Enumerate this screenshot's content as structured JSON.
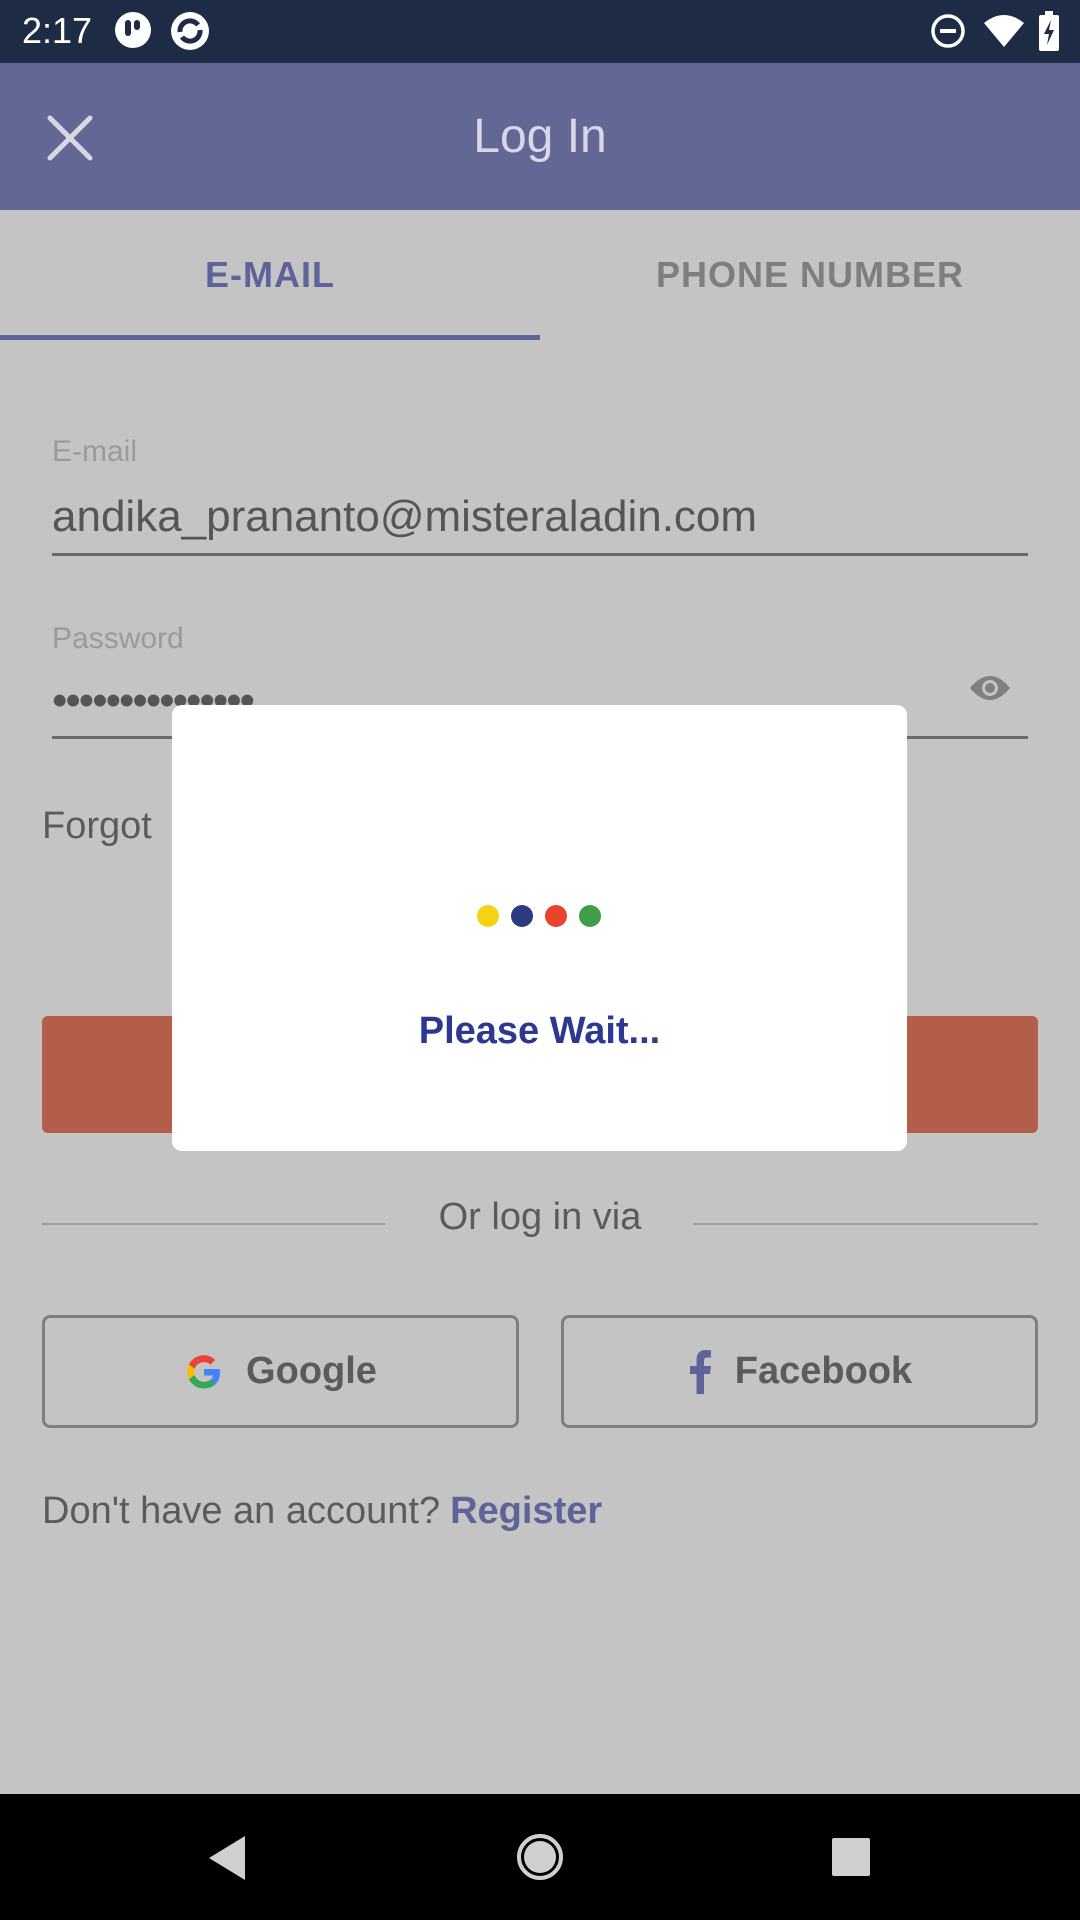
{
  "status_bar": {
    "time": "2:17"
  },
  "app_bar": {
    "title": "Log In"
  },
  "tabs": [
    {
      "label": "E-MAIL",
      "selected": true
    },
    {
      "label": "PHONE NUMBER",
      "selected": false
    }
  ],
  "email_field": {
    "label": "E-mail",
    "value": "andika_prananto@misteraladin.com"
  },
  "password_field": {
    "label": "Password",
    "value": "•••••••••••••••"
  },
  "forgot_link": "Forgot",
  "divider_text": "Or log in via",
  "social": {
    "google_label": "Google",
    "facebook_label": "Facebook"
  },
  "signup": {
    "prompt": "Don't have an account?",
    "link": "Register"
  },
  "dialog": {
    "message": "Please Wait..."
  },
  "colors": {
    "primary": "#636796",
    "accent_text": "#5e649a",
    "login_button": "#b35e48",
    "dialog_text": "#2d3892",
    "loading_dots": [
      "#f7d213",
      "#2b3d80",
      "#e8432d",
      "#3f9e46"
    ]
  }
}
